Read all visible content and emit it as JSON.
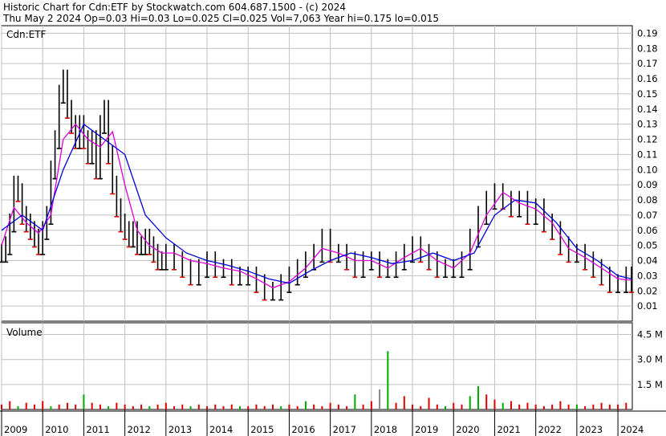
{
  "header": {
    "line1": "Historic Chart for Cdn:ETF by Stockwatch.com 604.687.1500 - (c) 2024",
    "line2": "Thu May  2 2024  Op=0.03  Hi=0.03  Lo=0.025  Cl=0.025  Vol=7,063  Year hi=0.175  lo=0.015"
  },
  "colors": {
    "background": "#ffffff",
    "grid": "#c0c0c0",
    "price_bars": "#000000",
    "down_bars": "#dd0000",
    "ma_short": "#dd00dd",
    "ma_long": "#0000dd",
    "volume_up": "#00aa00",
    "volume_down": "#dd0000",
    "volume_neutral": "#888888"
  },
  "chart_data": [
    {
      "type": "line",
      "title": "Cdn:ETF",
      "panel": "price",
      "y_ticks": [
        "0.19",
        "0.18",
        "0.17",
        "0.16",
        "0.15",
        "0.14",
        "0.13",
        "0.12",
        "0.11",
        "0.10",
        "0.09",
        "0.08",
        "0.07",
        "0.06",
        "0.05",
        "0.04",
        "0.03",
        "0.02",
        "0.01"
      ],
      "ylim": [
        0.0,
        0.195
      ],
      "x_ticks": [
        "2009",
        "2010",
        "2011",
        "2012",
        "2013",
        "2014",
        "2015",
        "2016",
        "2017",
        "2018",
        "2019",
        "2020",
        "2021",
        "2022",
        "2023",
        "2024"
      ],
      "xlim": [
        2009.0,
        2024.35
      ],
      "series": [
        {
          "role": "price",
          "x": [
            2009.0,
            2009.1,
            2009.2,
            2009.3,
            2009.4,
            2009.5,
            2009.6,
            2009.7,
            2009.8,
            2009.9,
            2010.0,
            2010.1,
            2010.2,
            2010.3,
            2010.4,
            2010.5,
            2010.6,
            2010.7,
            2010.8,
            2010.9,
            2011.0,
            2011.1,
            2011.2,
            2011.3,
            2011.4,
            2011.5,
            2011.6,
            2011.7,
            2011.8,
            2011.9,
            2012.0,
            2012.1,
            2012.2,
            2012.3,
            2012.4,
            2012.5,
            2012.6,
            2012.7,
            2012.8,
            2012.9,
            2013.0,
            2013.2,
            2013.4,
            2013.6,
            2013.8,
            2014.0,
            2014.2,
            2014.4,
            2014.6,
            2014.8,
            2015.0,
            2015.2,
            2015.4,
            2015.6,
            2015.8,
            2016.0,
            2016.2,
            2016.4,
            2016.6,
            2016.8,
            2017.0,
            2017.2,
            2017.4,
            2017.6,
            2017.8,
            2018.0,
            2018.2,
            2018.4,
            2018.6,
            2018.8,
            2019.0,
            2019.2,
            2019.4,
            2019.6,
            2019.8,
            2020.0,
            2020.2,
            2020.4,
            2020.6,
            2020.8,
            2021.0,
            2021.2,
            2021.4,
            2021.6,
            2021.8,
            2022.0,
            2022.2,
            2022.4,
            2022.6,
            2022.8,
            2023.0,
            2023.2,
            2023.4,
            2023.6,
            2023.8,
            2024.0,
            2024.2,
            2024.33
          ],
          "y": [
            0.045,
            0.05,
            0.065,
            0.09,
            0.085,
            0.07,
            0.065,
            0.06,
            0.055,
            0.05,
            0.06,
            0.07,
            0.1,
            0.12,
            0.15,
            0.16,
            0.14,
            0.13,
            0.12,
            0.13,
            0.12,
            0.11,
            0.12,
            0.1,
            0.13,
            0.14,
            0.11,
            0.09,
            0.075,
            0.065,
            0.06,
            0.055,
            0.06,
            0.05,
            0.05,
            0.055,
            0.05,
            0.045,
            0.04,
            0.04,
            0.045,
            0.04,
            0.035,
            0.03,
            0.035,
            0.04,
            0.035,
            0.035,
            0.03,
            0.03,
            0.03,
            0.025,
            0.02,
            0.02,
            0.025,
            0.03,
            0.035,
            0.04,
            0.045,
            0.055,
            0.045,
            0.045,
            0.04,
            0.035,
            0.04,
            0.04,
            0.035,
            0.035,
            0.04,
            0.045,
            0.05,
            0.045,
            0.04,
            0.035,
            0.035,
            0.035,
            0.04,
            0.055,
            0.07,
            0.08,
            0.085,
            0.08,
            0.075,
            0.08,
            0.07,
            0.075,
            0.065,
            0.06,
            0.05,
            0.045,
            0.045,
            0.04,
            0.035,
            0.03,
            0.025,
            0.025,
            0.03,
            0.025
          ]
        },
        {
          "role": "moving_average_short",
          "x": [
            2009.0,
            2009.3,
            2009.6,
            2009.9,
            2010.2,
            2010.5,
            2010.8,
            2011.1,
            2011.4,
            2011.7,
            2012.0,
            2012.3,
            2012.6,
            2012.9,
            2013.2,
            2013.6,
            2014.0,
            2014.4,
            2014.8,
            2015.2,
            2015.6,
            2016.0,
            2016.4,
            2016.8,
            2017.2,
            2017.6,
            2018.0,
            2018.4,
            2018.8,
            2019.2,
            2019.6,
            2020.0,
            2020.4,
            2020.8,
            2021.2,
            2021.6,
            2022.0,
            2022.4,
            2022.8,
            2023.2,
            2023.6,
            2024.0,
            2024.33
          ],
          "y": [
            0.05,
            0.075,
            0.065,
            0.058,
            0.07,
            0.12,
            0.13,
            0.12,
            0.115,
            0.125,
            0.09,
            0.06,
            0.05,
            0.045,
            0.045,
            0.04,
            0.038,
            0.035,
            0.033,
            0.028,
            0.022,
            0.026,
            0.035,
            0.048,
            0.045,
            0.04,
            0.04,
            0.035,
            0.042,
            0.048,
            0.04,
            0.035,
            0.045,
            0.07,
            0.085,
            0.078,
            0.074,
            0.065,
            0.048,
            0.042,
            0.035,
            0.028,
            0.027
          ]
        },
        {
          "role": "moving_average_long",
          "x": [
            2009.0,
            2009.5,
            2010.0,
            2010.5,
            2011.0,
            2011.5,
            2012.0,
            2012.5,
            2013.0,
            2013.5,
            2014.0,
            2014.5,
            2015.0,
            2015.5,
            2016.0,
            2016.5,
            2017.0,
            2017.5,
            2018.0,
            2018.5,
            2019.0,
            2019.5,
            2020.0,
            2020.5,
            2021.0,
            2021.5,
            2022.0,
            2022.5,
            2023.0,
            2023.5,
            2024.0,
            2024.33
          ],
          "y": [
            0.06,
            0.07,
            0.06,
            0.1,
            0.13,
            0.12,
            0.11,
            0.07,
            0.055,
            0.045,
            0.04,
            0.037,
            0.033,
            0.028,
            0.025,
            0.033,
            0.04,
            0.045,
            0.042,
            0.038,
            0.04,
            0.045,
            0.04,
            0.045,
            0.07,
            0.08,
            0.078,
            0.065,
            0.048,
            0.04,
            0.03,
            0.028
          ]
        }
      ]
    },
    {
      "type": "bar",
      "title": "Volume",
      "panel": "volume",
      "y_ticks": [
        "4.5 M",
        "3.0 M",
        "1.5 M"
      ],
      "ylim": [
        0,
        5.2
      ],
      "unit": "M",
      "x": [
        2009.0,
        2009.2,
        2009.4,
        2009.6,
        2009.8,
        2010.0,
        2010.2,
        2010.4,
        2010.6,
        2010.8,
        2011.0,
        2011.2,
        2011.4,
        2011.6,
        2011.8,
        2012.0,
        2012.2,
        2012.4,
        2012.6,
        2012.8,
        2013.0,
        2013.2,
        2013.4,
        2013.6,
        2013.8,
        2014.0,
        2014.2,
        2014.4,
        2014.6,
        2014.8,
        2015.0,
        2015.2,
        2015.4,
        2015.6,
        2015.8,
        2016.0,
        2016.2,
        2016.4,
        2016.6,
        2016.8,
        2017.0,
        2017.2,
        2017.4,
        2017.6,
        2017.8,
        2018.0,
        2018.2,
        2018.4,
        2018.6,
        2018.8,
        2019.0,
        2019.2,
        2019.4,
        2019.6,
        2019.8,
        2020.0,
        2020.2,
        2020.4,
        2020.6,
        2020.8,
        2021.0,
        2021.2,
        2021.4,
        2021.6,
        2021.8,
        2022.0,
        2022.2,
        2022.4,
        2022.6,
        2022.8,
        2023.0,
        2023.2,
        2023.4,
        2023.6,
        2023.8,
        2024.0,
        2024.2
      ],
      "values": [
        0.3,
        0.5,
        0.2,
        0.4,
        0.3,
        0.5,
        0.2,
        0.3,
        0.4,
        0.3,
        0.9,
        0.4,
        0.3,
        0.2,
        0.4,
        0.3,
        0.2,
        0.3,
        0.2,
        0.3,
        0.4,
        0.2,
        0.3,
        0.2,
        0.3,
        0.2,
        0.3,
        0.2,
        0.3,
        0.2,
        0.2,
        0.3,
        0.2,
        0.3,
        0.2,
        0.3,
        0.2,
        0.5,
        0.3,
        0.2,
        0.4,
        0.3,
        0.2,
        0.9,
        0.3,
        0.5,
        1.2,
        3.5,
        0.4,
        0.8,
        0.3,
        0.2,
        0.7,
        0.3,
        0.2,
        0.4,
        0.3,
        0.8,
        1.4,
        0.9,
        0.6,
        0.4,
        0.5,
        0.3,
        0.4,
        0.3,
        0.2,
        0.3,
        0.5,
        0.3,
        0.3,
        0.2,
        0.3,
        0.4,
        0.3,
        0.3,
        0.4
      ],
      "colors": [
        "r",
        "r",
        "g",
        "r",
        "r",
        "r",
        "g",
        "r",
        "r",
        "r",
        "g",
        "r",
        "r",
        "g",
        "r",
        "r",
        "r",
        "r",
        "g",
        "r",
        "r",
        "r",
        "r",
        "g",
        "r",
        "r",
        "r",
        "r",
        "r",
        "g",
        "r",
        "r",
        "r",
        "r",
        "g",
        "r",
        "r",
        "g",
        "r",
        "r",
        "r",
        "r",
        "r",
        "g",
        "r",
        "r",
        "n",
        "g",
        "r",
        "r",
        "r",
        "r",
        "r",
        "r",
        "g",
        "r",
        "r",
        "g",
        "g",
        "r",
        "r",
        "g",
        "r",
        "r",
        "r",
        "r",
        "r",
        "r",
        "r",
        "r",
        "g",
        "r",
        "r",
        "r",
        "r",
        "r",
        "r"
      ]
    }
  ]
}
